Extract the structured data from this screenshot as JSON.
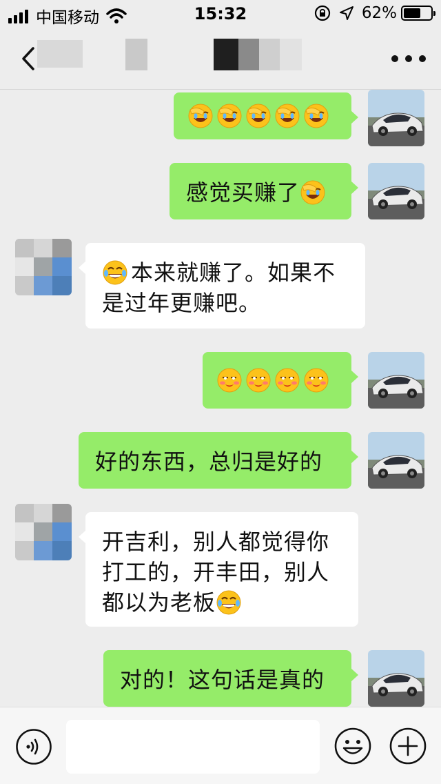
{
  "status_bar": {
    "carrier": "中国移动",
    "time": "15:32",
    "battery_percent": "62%",
    "battery_level": 0.62
  },
  "nav": {
    "title": "",
    "back_icon": "chevron-left-icon",
    "more_icon": "more-dots-icon"
  },
  "messages": [
    {
      "side": "sent",
      "text": "",
      "emoji_count": 5,
      "emoji": "facepalm-laugh"
    },
    {
      "side": "sent",
      "text": "感觉买赚了",
      "emoji_count": 1,
      "emoji": "facepalm-laugh"
    },
    {
      "side": "recv",
      "lines": [
        "本来就赚了。如果不",
        "是过年更赚吧。"
      ],
      "lead_emoji": "tears-of-joy"
    },
    {
      "side": "sent",
      "text": "",
      "emoji_count": 4,
      "emoji": "smirk-blush"
    },
    {
      "side": "sent",
      "text": "好的东西，总归是好的"
    },
    {
      "side": "recv",
      "lines": [
        "开吉利，别人都觉得你",
        "打工的，开丰田，别人",
        "都以为老板"
      ],
      "trail_emoji": "tears-of-joy"
    },
    {
      "side": "sent",
      "text": "对的！这句话是真的"
    }
  ],
  "input_bar": {
    "placeholder": "",
    "voice_icon": "voice-icon",
    "emoji_icon": "smiley-icon",
    "plus_icon": "plus-icon"
  },
  "colors": {
    "sent_bubble": "#95ec69",
    "recv_bubble": "#ffffff",
    "background": "#ededed"
  }
}
